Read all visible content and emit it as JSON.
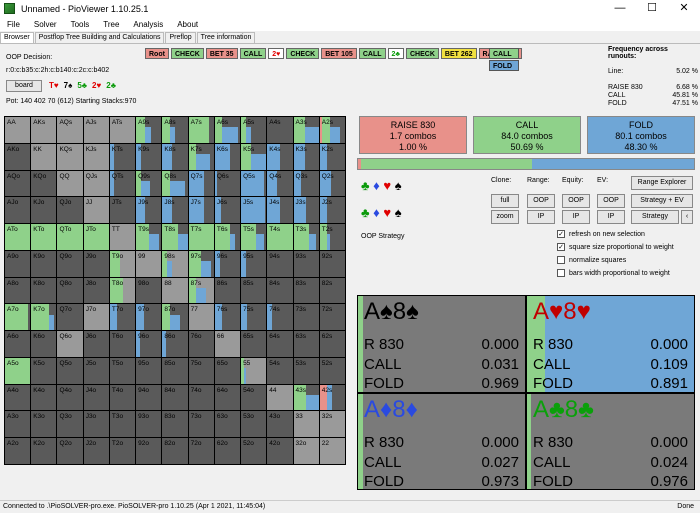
{
  "window": {
    "title": "Unnamed - PioViewer 1.10.25.1",
    "min": "—",
    "max": "☐",
    "close": "✕"
  },
  "menu": [
    "File",
    "Solver",
    "Tools",
    "Tree",
    "Analysis",
    "About"
  ],
  "tabs": [
    "Browser",
    "Postflop Tree Building and Calculations",
    "Preflop",
    "Tree information"
  ],
  "info": {
    "decision": "OOP Decision:",
    "line": "r:0:c:b35:c:2h:c:b140:c:2c:c:b402",
    "board_btn": "board",
    "pot": "Pot: 140 402 70 (612) Starting Stacks:970",
    "cards": [
      {
        "t": "T♥",
        "c": "#e00000"
      },
      {
        "t": "7♠",
        "c": "#000000"
      },
      {
        "t": "5♣",
        "c": "#0a9a0a"
      },
      {
        "t": "2♥",
        "c": "#e00000"
      },
      {
        "t": "2♣",
        "c": "#0a9a0a"
      }
    ]
  },
  "breadcrumb": [
    {
      "t": "Root",
      "k": "root"
    },
    {
      "t": "CHECK",
      "k": "check"
    },
    {
      "t": "BET 35",
      "k": "bet"
    },
    {
      "t": "CALL",
      "k": "call"
    },
    {
      "t": "2♥",
      "k": "card",
      "c": "#e00000"
    },
    {
      "t": "CHECK",
      "k": "check"
    },
    {
      "t": "BET 105",
      "k": "bet"
    },
    {
      "t": "CALL",
      "k": "call"
    },
    {
      "t": "2♣",
      "k": "card",
      "c": "#0a9a0a"
    },
    {
      "t": "CHECK",
      "k": "check"
    },
    {
      "t": "BET 262",
      "k": "bety"
    },
    {
      "t": "RAISE 830",
      "k": "bet"
    }
  ],
  "actions": [
    {
      "t": "CALL",
      "c": "#8fd18a"
    },
    {
      "t": "FOLD",
      "c": "#6fa6d6"
    }
  ],
  "freq": {
    "title": "Frequency across runouts:",
    "rows": [
      {
        "k": "Line:",
        "v": "5.02 %"
      },
      {
        "k": "RAISE 830",
        "v": "6.68 %"
      },
      {
        "k": "CALL",
        "v": "45.81 %"
      },
      {
        "k": "FOLD",
        "v": "47.51 %"
      }
    ]
  },
  "colors": {
    "raise": "#e8918a",
    "call": "#8fd18a",
    "fold": "#6fa6d6",
    "empty": "#5a5a5a",
    "light": "#9a9a9a"
  },
  "grid": {
    "labels": [
      [
        "AA",
        "AKs",
        "AQs",
        "AJs",
        "ATs",
        "A9s",
        "A8s",
        "A7s",
        "A6s",
        "A5s",
        "A4s",
        "A3s",
        "A2s"
      ],
      [
        "AKo",
        "KK",
        "KQs",
        "KJs",
        "KTs",
        "K9s",
        "K8s",
        "K7s",
        "K6s",
        "K5s",
        "K4s",
        "K3s",
        "K2s"
      ],
      [
        "AQo",
        "KQo",
        "QQ",
        "QJs",
        "QTs",
        "Q9s",
        "Q8s",
        "Q7s",
        "Q6s",
        "Q5s",
        "Q4s",
        "Q3s",
        "Q2s"
      ],
      [
        "AJo",
        "KJo",
        "QJo",
        "JJ",
        "JTs",
        "J9s",
        "J8s",
        "J7s",
        "J6s",
        "J5s",
        "J4s",
        "J3s",
        "J2s"
      ],
      [
        "ATo",
        "KTo",
        "QTo",
        "JTo",
        "TT",
        "T9s",
        "T8s",
        "T7s",
        "T6s",
        "T5s",
        "T4s",
        "T3s",
        "T2s"
      ],
      [
        "A9o",
        "K9o",
        "Q9o",
        "J9o",
        "T9o",
        "99",
        "98s",
        "97s",
        "96s",
        "95s",
        "94s",
        "93s",
        "92s"
      ],
      [
        "A8o",
        "K8o",
        "Q8o",
        "J8o",
        "T8o",
        "98o",
        "88",
        "87s",
        "86s",
        "85s",
        "84s",
        "83s",
        "82s"
      ],
      [
        "A7o",
        "K7o",
        "Q7o",
        "J7o",
        "T7o",
        "97o",
        "87o",
        "77",
        "76s",
        "75s",
        "74s",
        "73s",
        "72s"
      ],
      [
        "A6o",
        "K6o",
        "Q6o",
        "J6o",
        "T6o",
        "96o",
        "86o",
        "76o",
        "66",
        "65s",
        "64s",
        "63s",
        "62s"
      ],
      [
        "A5o",
        "K5o",
        "Q5o",
        "J5o",
        "T5o",
        "95o",
        "85o",
        "75o",
        "65o",
        "55",
        "54s",
        "53s",
        "52s"
      ],
      [
        "A4o",
        "K4o",
        "Q4o",
        "J4o",
        "T4o",
        "94o",
        "84o",
        "74o",
        "64o",
        "54o",
        "44",
        "43s",
        "42s"
      ],
      [
        "A3o",
        "K3o",
        "Q3o",
        "J3o",
        "T3o",
        "93o",
        "83o",
        "73o",
        "63o",
        "53o",
        "43o",
        "33",
        "32s"
      ],
      [
        "A2o",
        "K2o",
        "Q2o",
        "J2o",
        "T2o",
        "92o",
        "82o",
        "72o",
        "62o",
        "52o",
        "42o",
        "32o",
        "22"
      ]
    ],
    "cells": {
      "0,5": [
        0,
        0.35,
        0.25
      ],
      "0,6": [
        0,
        0.3,
        0.2
      ],
      "0,7": [
        0,
        0.8,
        0
      ],
      "0,8": [
        0,
        0.3,
        0.6
      ],
      "0,9": [
        0,
        0.2,
        0.2
      ],
      "0,11": [
        0,
        0.45,
        0.55
      ],
      "0,12": [
        0.1,
        0.3,
        0.4
      ],
      "1,4": [
        0,
        0,
        0.15
      ],
      "1,5": [
        0,
        0,
        0.2
      ],
      "1,6": [
        0,
        0,
        0.4
      ],
      "1,7": [
        0,
        0.3,
        0.55
      ],
      "1,8": [
        0,
        0,
        0.6
      ],
      "1,9": [
        0,
        0.4,
        0.6
      ],
      "1,10": [
        0,
        0,
        0.5
      ],
      "1,11": [
        0,
        0,
        0.45
      ],
      "1,12": [
        0,
        0,
        0.3
      ],
      "2,4": [
        0,
        0,
        0.15
      ],
      "2,5": [
        0,
        0.2,
        0.35
      ],
      "2,6": [
        0,
        0.3,
        0.6
      ],
      "2,7": [
        0,
        0,
        0.6
      ],
      "2,8": [
        0,
        0,
        0.1
      ],
      "2,9": [
        0,
        0,
        0.9
      ],
      "2,10": [
        0,
        0,
        0.4
      ],
      "2,11": [
        0,
        0,
        0.3
      ],
      "2,12": [
        0,
        0,
        0.45
      ],
      "3,5": [
        0,
        0,
        0.35
      ],
      "3,6": [
        0,
        0,
        0.4
      ],
      "3,7": [
        0,
        0,
        0.6
      ],
      "3,8": [
        0,
        0,
        0.25
      ],
      "3,9": [
        0,
        0,
        0.95
      ],
      "3,10": [
        0,
        0,
        0.5
      ],
      "3,11": [
        0,
        0,
        0.5
      ],
      "3,12": [
        0,
        0,
        0.3
      ],
      "4,0": [
        0,
        1,
        0
      ],
      "4,1": [
        0,
        1,
        0
      ],
      "4,2": [
        0,
        1,
        0
      ],
      "4,3": [
        0,
        1,
        0
      ],
      "4,5": [
        0,
        0.5,
        0.4
      ],
      "4,6": [
        0,
        0.6,
        0.4
      ],
      "4,7": [
        0,
        1,
        0
      ],
      "4,8": [
        0,
        0.6,
        0.2
      ],
      "4,9": [
        0,
        0.6,
        0.3
      ],
      "4,10": [
        0,
        1,
        0
      ],
      "4,11": [
        0,
        0.6,
        0.3
      ],
      "4,12": [
        0,
        0.3,
        0.1
      ],
      "5,4": [
        0,
        0.4,
        0
      ],
      "5,6": [
        0,
        0.2,
        0.2
      ],
      "5,7": [
        0,
        0.5,
        0.4
      ],
      "5,8": [
        0,
        0,
        0.2
      ],
      "5,9": [
        0,
        0,
        0.2
      ],
      "6,4": [
        0,
        0.5,
        0
      ],
      "6,6": [
        0,
        0,
        0
      ],
      "6,7": [
        0,
        0.3,
        0.4
      ],
      "7,0": [
        0,
        0.9,
        0
      ],
      "7,1": [
        0,
        0.7,
        0.2
      ],
      "7,4": [
        0,
        0,
        0.3
      ],
      "7,5": [
        0,
        0,
        0.3
      ],
      "7,6": [
        0,
        0.3,
        0.4
      ],
      "7,8": [
        0,
        0,
        0.3
      ],
      "7,9": [
        0,
        0,
        0.25
      ],
      "7,10": [
        0,
        0,
        0.2
      ],
      "8,5": [
        0,
        0,
        0.15
      ],
      "8,6": [
        0,
        0,
        0.15
      ],
      "9,0": [
        0,
        1,
        0
      ],
      "9,9": [
        0,
        0.1,
        0.1
      ],
      "10,10": [
        0,
        0,
        0
      ],
      "10,11": [
        0,
        0.5,
        0.5
      ],
      "10,12": [
        0.3,
        0,
        0.2
      ]
    },
    "light": [
      "0,0",
      "1,1",
      "2,2",
      "3,3",
      "4,4",
      "5,5",
      "6,6",
      "7,7",
      "8,8",
      "9,9",
      "10,10",
      "11,11",
      "12,12",
      "0,1",
      "0,2",
      "0,3",
      "0,4",
      "1,2",
      "1,3",
      "2,3",
      "5,6",
      "6,7",
      "11,12",
      "12,11",
      "10,10",
      "5,4",
      "6,4",
      "7,3",
      "8,2"
    ]
  },
  "summary": [
    {
      "name": "RAISE 830",
      "combos": "1.7 combos",
      "pct": "1.00 %",
      "c": "#e8918a"
    },
    {
      "name": "CALL",
      "combos": "84.0 combos",
      "pct": "50.69 %",
      "c": "#8fd18a"
    },
    {
      "name": "FOLD",
      "combos": "80.1 combos",
      "pct": "48.30 %",
      "c": "#6fa6d6"
    }
  ],
  "bigbar": [
    0.01,
    0.5069,
    0.483
  ],
  "controls": {
    "clone": "Clone:",
    "range": "Range:",
    "equity": "Equity:",
    "ev": "EV:",
    "range_explorer": "Range Explorer",
    "full": "full",
    "zoom": "zoom",
    "oop1": "OOP",
    "ip1": "IP",
    "oop2": "OOP",
    "ip2": "IP",
    "oop3": "OOP",
    "ip3": "IP",
    "strategy_ev": "Strategy + EV",
    "strategy": "Strategy",
    "arrow": "‹",
    "oop_strategy": "OOP Strategy",
    "checks": [
      {
        "t": "refresh on new selection",
        "v": true
      },
      {
        "t": "square size proportional to weight",
        "v": true
      },
      {
        "t": "normalize squares",
        "v": false
      },
      {
        "t": "bars width proportional to weight",
        "v": false
      }
    ]
  },
  "combos": [
    {
      "name": "A♠8♠",
      "c": "#000000",
      "r": "0.000",
      "call": "0.031",
      "fold": "0.969",
      "fill": [
        0,
        0.031,
        0
      ]
    },
    {
      "name": "A♥8♥",
      "c": "#c00000",
      "r": "0.000",
      "call": "0.109",
      "fold": "0.891",
      "fill": [
        0,
        0.109,
        0.891
      ]
    },
    {
      "name": "A♦8♦",
      "c": "#2a4ae0",
      "r": "0.000",
      "call": "0.027",
      "fold": "0.973",
      "fill": [
        0,
        0.027,
        0
      ]
    },
    {
      "name": "A♣8♣",
      "c": "#0aa00a",
      "r": "0.000",
      "call": "0.024",
      "fold": "0.976",
      "fill": [
        0,
        0.024,
        0
      ]
    }
  ],
  "combo_labels": {
    "r": "R 830",
    "call": "CALL",
    "fold": "FOLD"
  },
  "status": {
    "left": "Connected to .\\PioSOLVER-pro.exe. PioSOLVER-pro 1.10.25 (Apr  1 2021, 11:45:04)",
    "right": "Done"
  }
}
